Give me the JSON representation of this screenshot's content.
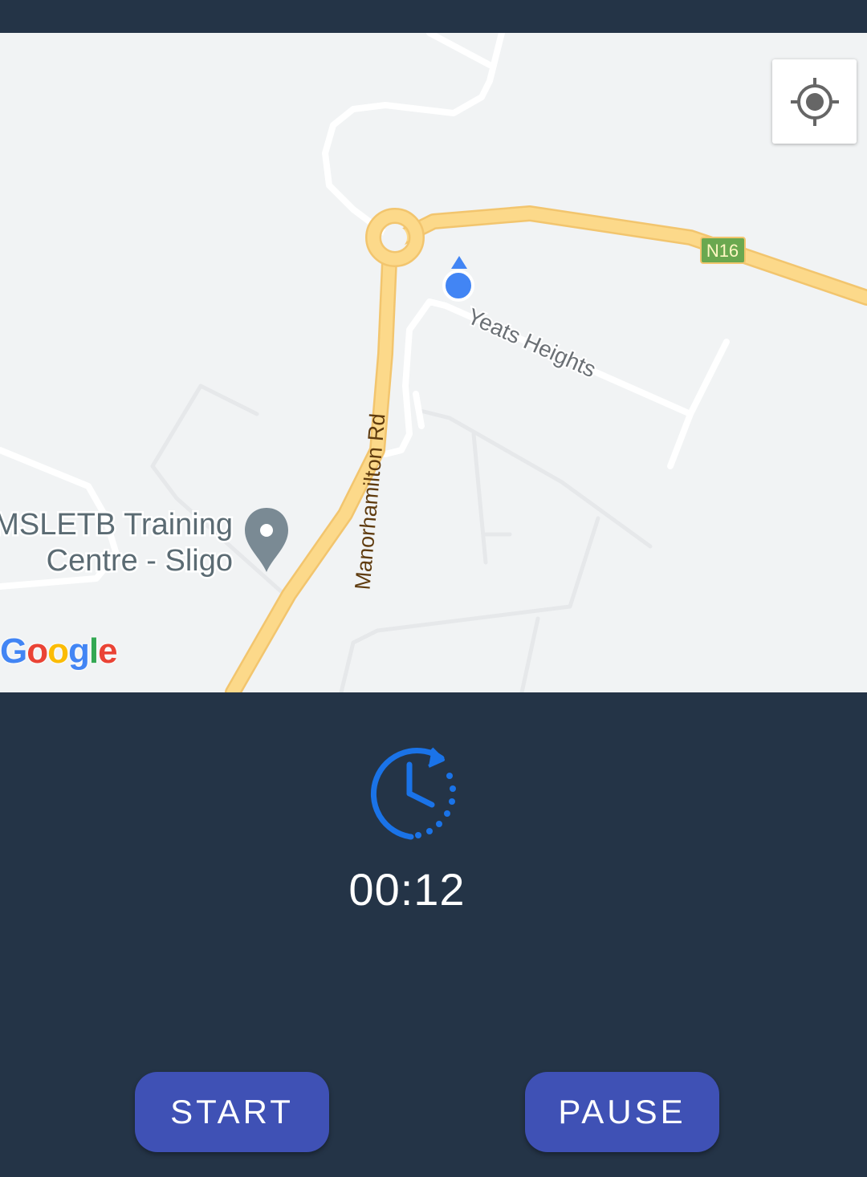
{
  "map": {
    "road_labels": {
      "manorhamilton": "Manorhamilton Rd",
      "yeats": "Yeats Heights",
      "route_shield": "N16"
    },
    "poi": {
      "name_line1": "MSLETB Training",
      "name_line2": "Centre - Sligo",
      "icon": "map-pin-icon"
    },
    "attribution": {
      "g1": "G",
      "g2": "o",
      "g3": "o",
      "g4": "g",
      "g5": "l",
      "g6": "e"
    },
    "locate_button_icon": "my-location-icon",
    "user_location_icon": "user-location-dot-icon"
  },
  "timer": {
    "icon": "timer-restart-icon",
    "elapsed": "00:12"
  },
  "controls": {
    "start_label": "START",
    "pause_label": "PAUSE"
  },
  "colors": {
    "background": "#243447",
    "button": "#3f51b5",
    "timer_icon": "#1a73e8",
    "map_bg": "#f1f3f4",
    "major_road": "#fcd98a",
    "route_shield": "#6aa84f"
  }
}
